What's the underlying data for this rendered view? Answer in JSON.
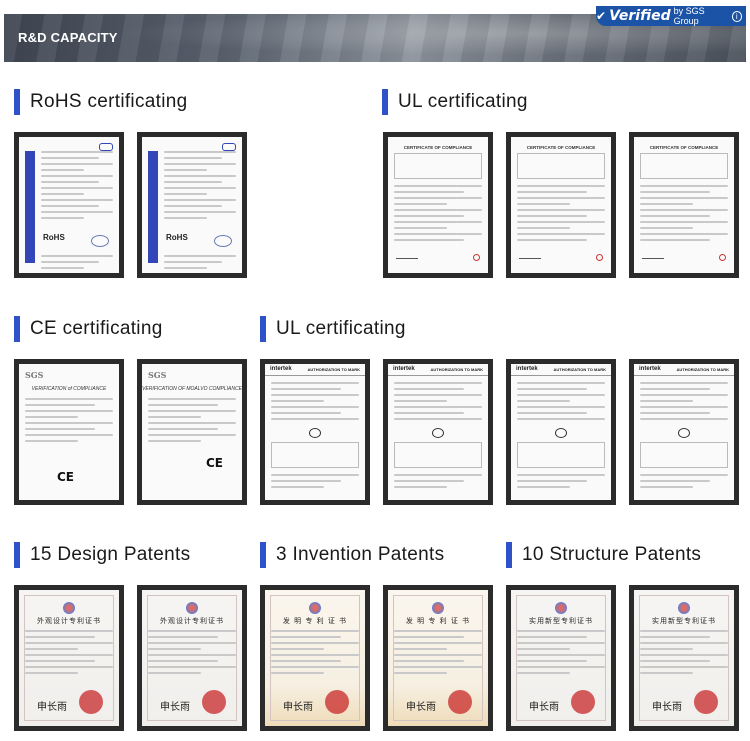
{
  "banner": {
    "title": "R&D CAPACITY",
    "badge": {
      "verified": "Verified",
      "by": "by SGS Group",
      "info": "i"
    }
  },
  "sections": {
    "rohs": "RoHS certificating",
    "ul_top": "UL certificating",
    "ce": "CE certificating",
    "ul_mid": "UL certificating",
    "design": "15 Design Patents",
    "invention": "3 Invention Patents",
    "structure": "10 Structure Patents"
  },
  "certificates": {
    "rohs_label": "RoHS",
    "ul_head": "CERTIFICATE OF COMPLIANCE",
    "sgs_logo": "SGS",
    "sgs_head_1": "VERIFICATION of COMPLIANCE",
    "sgs_head_2": "VERIFICATION OF MOALVO COMPLIANCE",
    "ce_mark": "CE",
    "intertek_brand": "intertek",
    "intertek_auth": "AUTHORIZATION TO MARK",
    "design_title": "外观设计专利证书",
    "invention_title": "发 明 专 利 证 书",
    "structure_title": "实用新型专利证书",
    "signature": "申长雨"
  },
  "colors": {
    "accent_bar": "#2f52c9",
    "badge_blue": "#1b53a6",
    "frame": "#2b2b2b"
  }
}
